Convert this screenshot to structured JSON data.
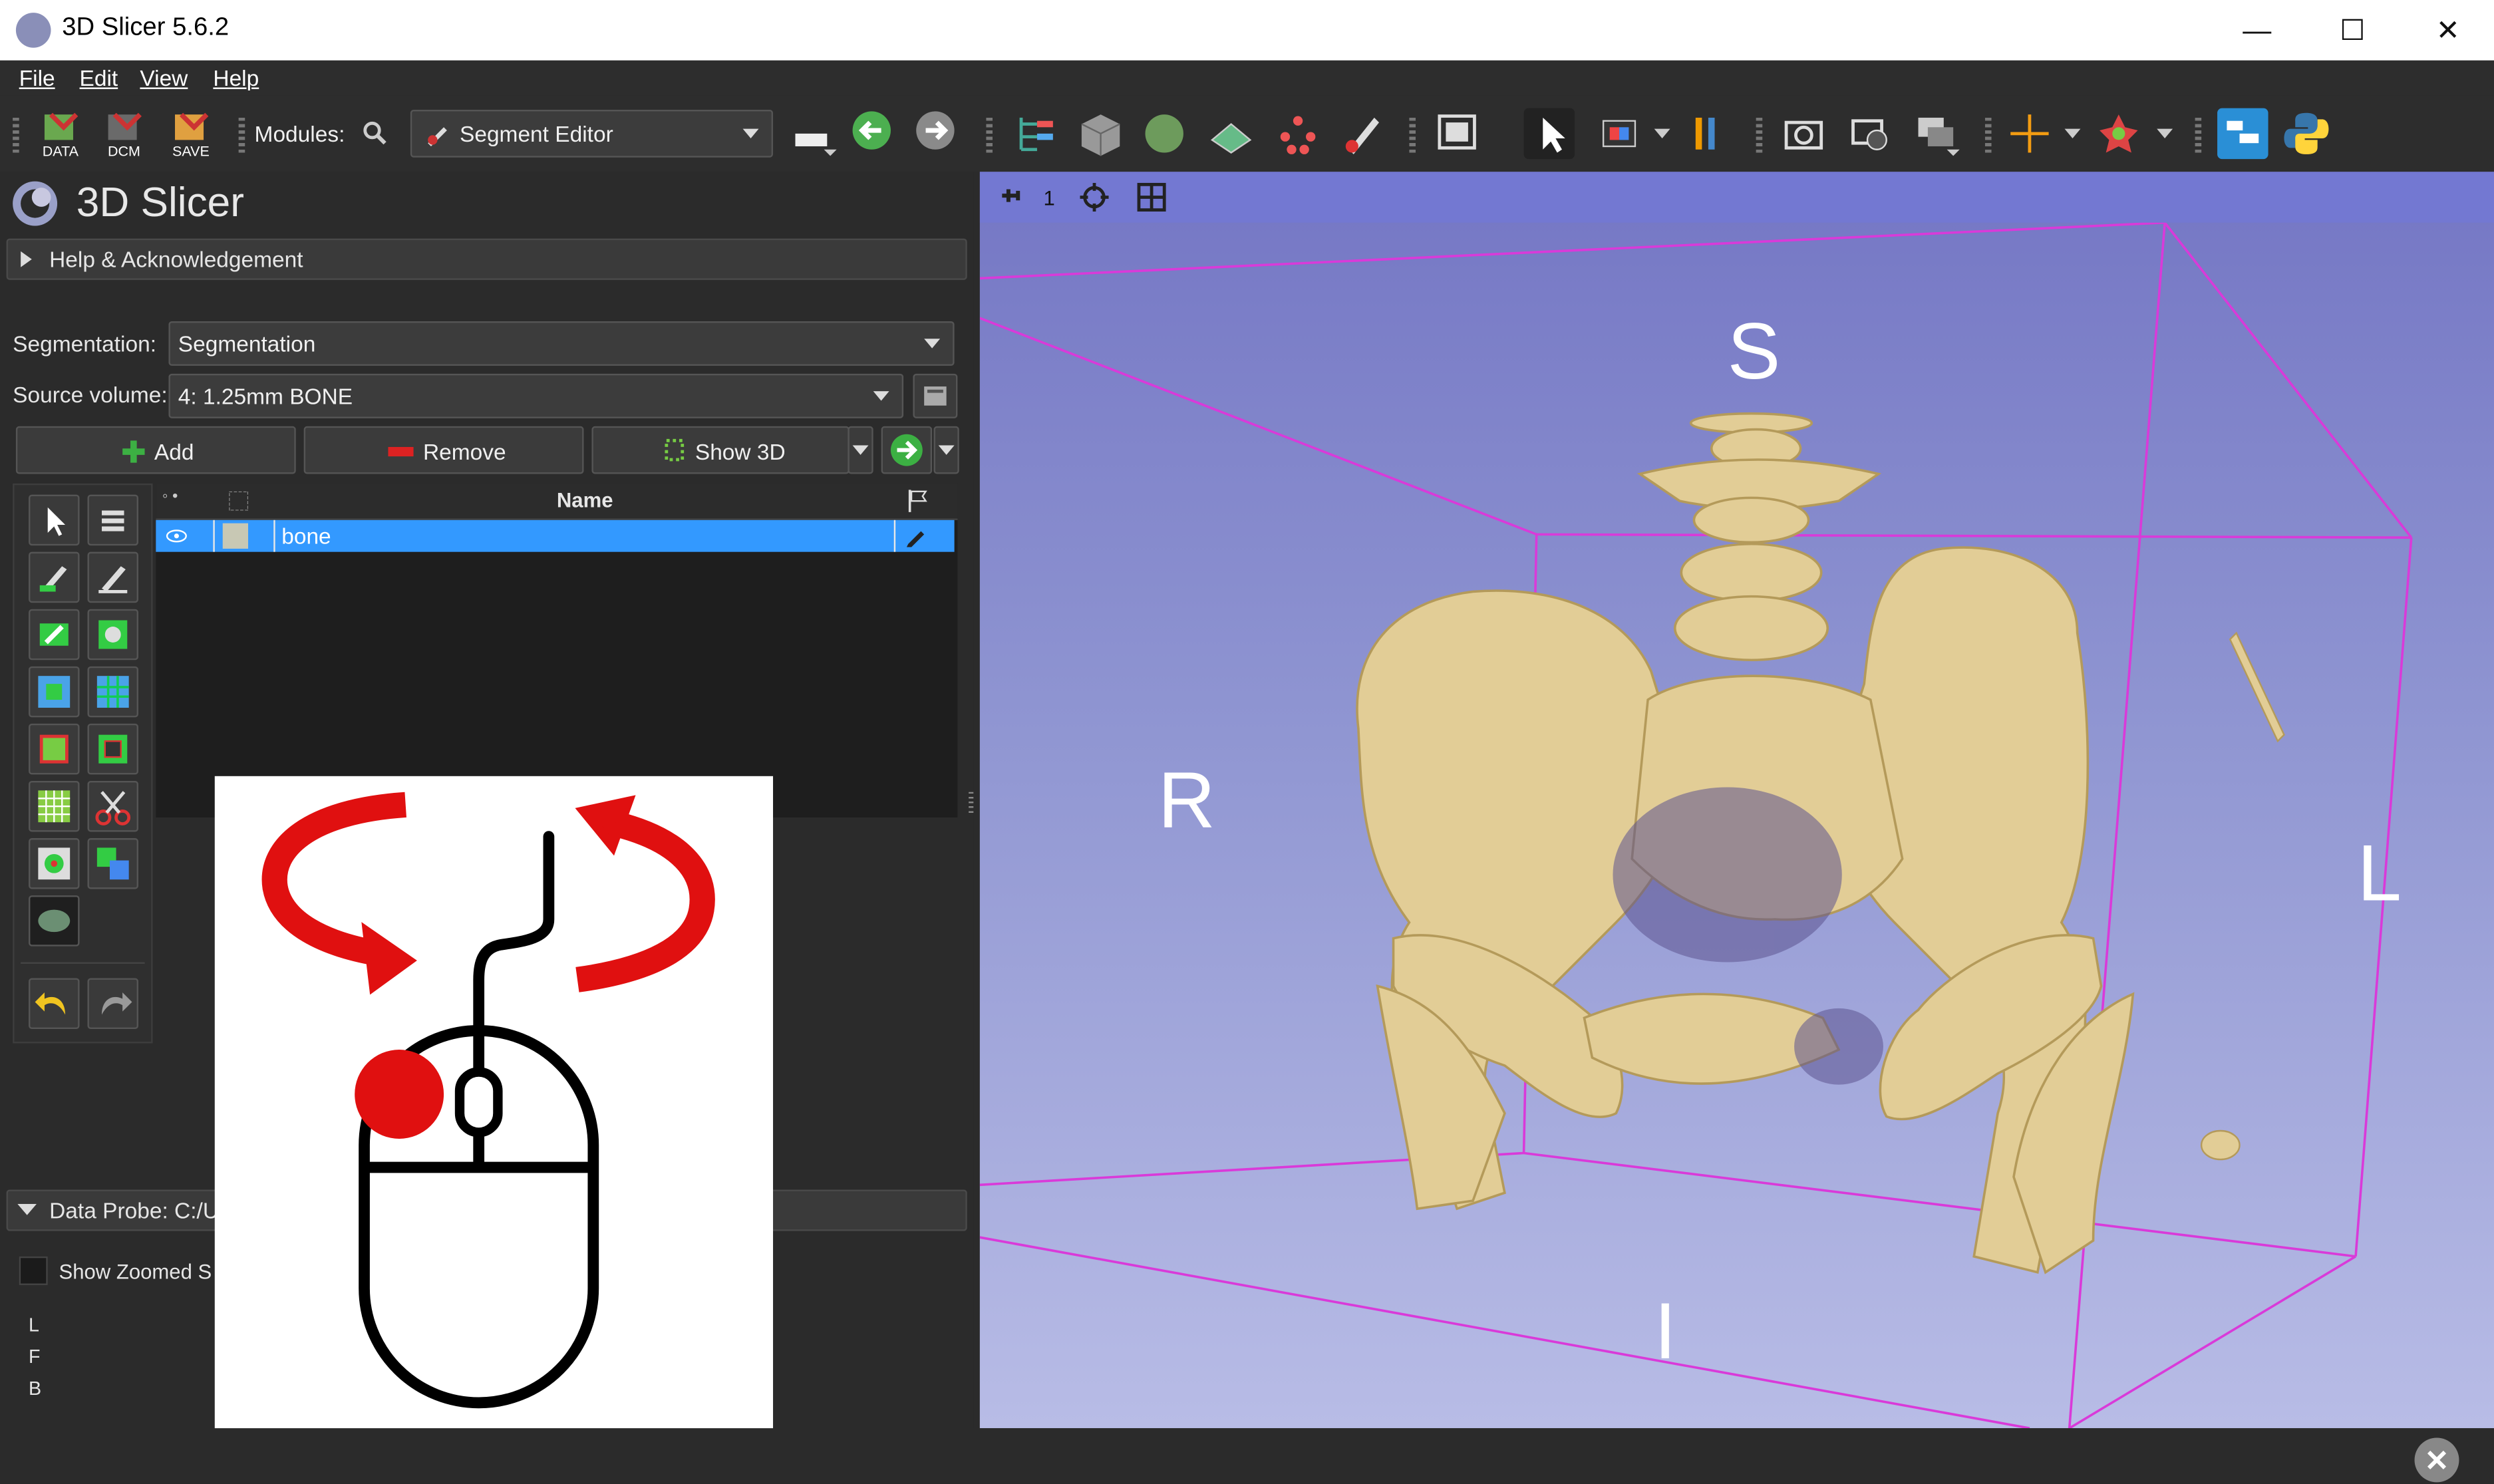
{
  "window": {
    "title": "3D Slicer 5.6.2",
    "minimize": "—",
    "maximize": "☐",
    "close": "✕"
  },
  "menu": [
    "File",
    "Edit",
    "View",
    "Help"
  ],
  "toolbar": {
    "data_label": "DATA",
    "dcm_label": "DCM",
    "save_label": "SAVE",
    "modules_label": "Modules:",
    "module_selected": "Segment Editor"
  },
  "panel": {
    "logo_text": "3D Slicer",
    "help_section": "Help & Acknowledgement",
    "segmentation_label": "Segmentation:",
    "segmentation_value": "Segmentation",
    "source_volume_label": "Source volume:",
    "source_volume_value": "4: 1.25mm BONE",
    "add_button": "Add",
    "remove_button": "Remove",
    "show3d_button": "Show 3D",
    "table_header_name": "Name",
    "segments": [
      {
        "name": "bone",
        "color": "#c8c8b4"
      }
    ],
    "data_probe_label": "Data Probe: C:/U",
    "show_zoomed_label": "Show Zoomed S",
    "probe_rows": [
      "L",
      "F",
      "B"
    ]
  },
  "viewer": {
    "view_number": "1",
    "orientation": {
      "superior": "S",
      "right": "R",
      "left": "L",
      "inferior": "I"
    },
    "background_top": "#7476c4",
    "background_bottom": "#b8bce6",
    "bone_color": "#e2cd96",
    "box_color": "#d93ad9"
  },
  "colors": {
    "accent_selection": "#3399ff",
    "arrow_red": "#e01010"
  }
}
